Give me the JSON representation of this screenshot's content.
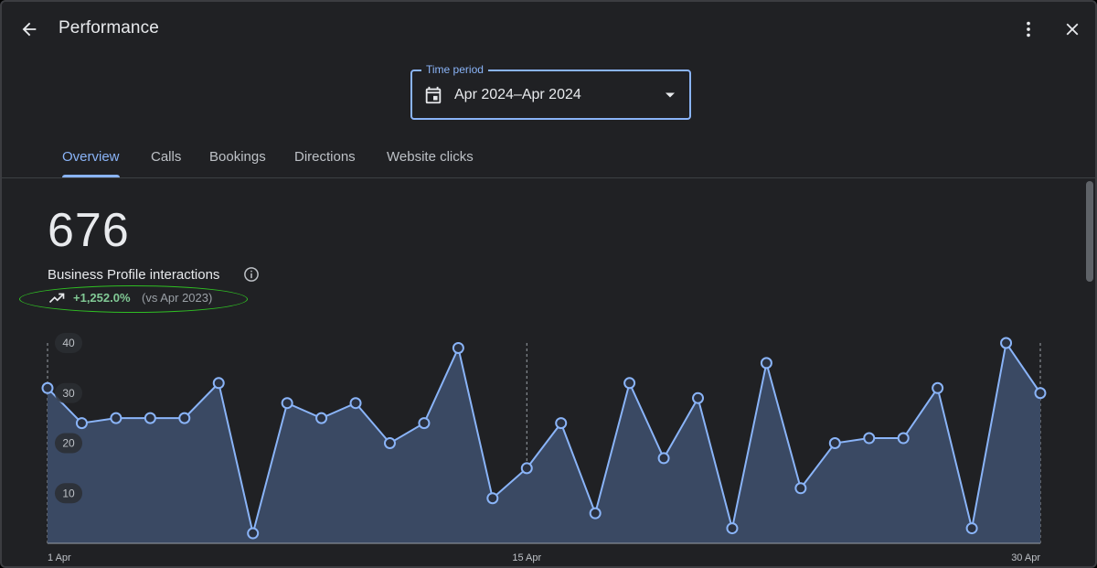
{
  "header": {
    "title": "Performance",
    "back_icon": "arrow-back-icon",
    "more_icon": "more-vert-icon",
    "close_icon": "close-icon"
  },
  "time_period": {
    "legend": "Time period",
    "value": "Apr 2024–Apr 2024",
    "icon": "calendar-icon"
  },
  "tabs": [
    {
      "label": "Overview",
      "active": true
    },
    {
      "label": "Calls",
      "active": false
    },
    {
      "label": "Bookings",
      "active": false
    },
    {
      "label": "Directions",
      "active": false
    },
    {
      "label": "Website clicks",
      "active": false
    }
  ],
  "summary": {
    "total": "676",
    "label": "Business Profile interactions",
    "change_pct": "+1,252.0%",
    "change_vs": "(vs Apr 2023)",
    "trend_icon": "trending-up-icon",
    "info_icon": "info-icon"
  },
  "colors": {
    "accent": "#8ab4f8",
    "positive": "#81c995",
    "highlight_ellipse": "#2fbf23",
    "area_fill": "#3a4963"
  },
  "chart_data": {
    "type": "area",
    "x": [
      1,
      2,
      3,
      4,
      5,
      6,
      7,
      8,
      9,
      10,
      11,
      12,
      13,
      14,
      15,
      16,
      17,
      18,
      19,
      20,
      21,
      22,
      23,
      24,
      25,
      26,
      27,
      28,
      29,
      30
    ],
    "values": [
      31,
      24,
      25,
      25,
      25,
      32,
      2,
      28,
      25,
      28,
      20,
      24,
      39,
      9,
      15,
      24,
      6,
      32,
      17,
      29,
      3,
      36,
      11,
      20,
      21,
      21,
      31,
      3,
      40,
      30
    ],
    "ylim": [
      0,
      40
    ],
    "y_ticks": [
      "10",
      "20",
      "30",
      "40"
    ],
    "x_tick_labels": [
      "1 Apr",
      "15 Apr",
      "30 Apr"
    ],
    "x_tick_positions": [
      1,
      15,
      30
    ],
    "grid": false,
    "xlabel": "",
    "ylabel": ""
  }
}
